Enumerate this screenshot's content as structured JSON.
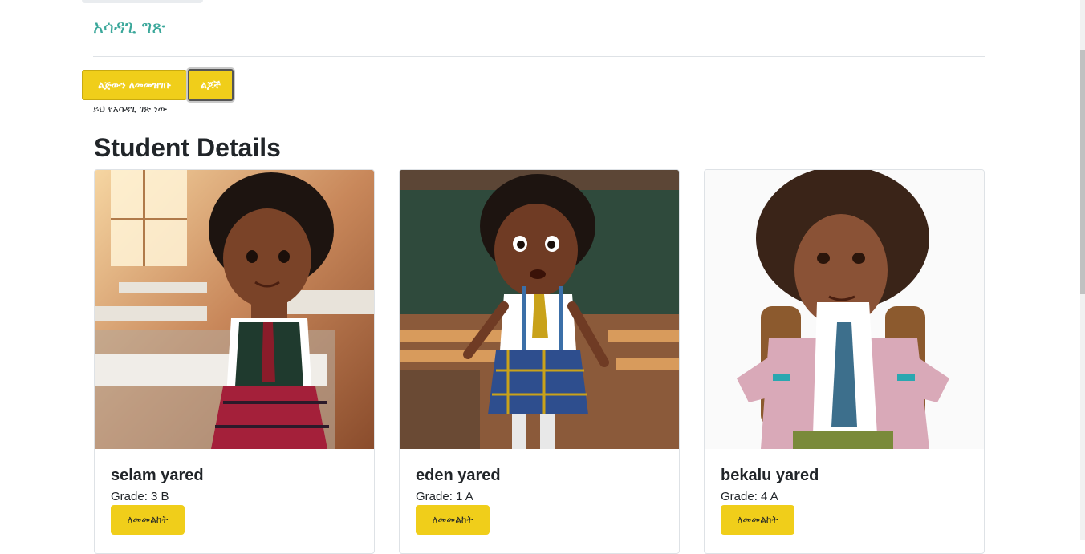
{
  "header": {
    "title": "አሳዳጊ ግጽ"
  },
  "actions": {
    "register_label": "ልጅውን ለመመዝገቡ",
    "children_label": "ልጆች"
  },
  "intro_text": "ይህ የአሳዳጊ ገጽ ነው",
  "section": {
    "title": "Student Details"
  },
  "students": [
    {
      "name": "selam yared",
      "grade": "Grade: 3 B",
      "button_label": "ለመመልከት",
      "image": "girl-student-classroom-photo"
    },
    {
      "name": "eden yared",
      "grade": "Grade: 1 A",
      "button_label": "ለመመልከት",
      "image": "boy-student-classroom-photo"
    },
    {
      "name": "bekalu yared",
      "grade": "Grade: 4 A",
      "button_label": "ለመመልከት",
      "image": "student-with-backpack-photo"
    }
  ],
  "colors": {
    "accent": "#f0ce1a",
    "title": "#3aa79a"
  }
}
